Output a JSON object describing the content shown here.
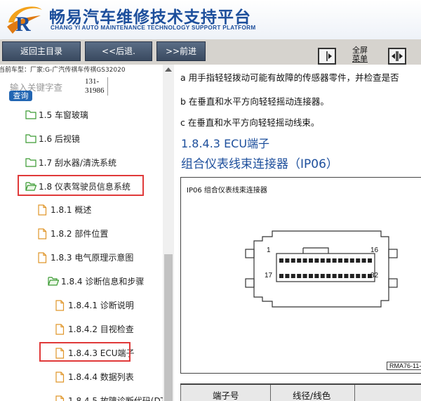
{
  "header": {
    "title_cn": "畅易汽车维修技术支持平台",
    "title_en": "CHANG YI AUTO MAINTENANCE TECHNOLOGY SUPPORT PLATFORM"
  },
  "toolbar": {
    "back_home": "返回主目录",
    "back": "<<后退.",
    "forward": ">>前进",
    "fullscreen_line1": "全屏",
    "fullscreen_line2": "菜单"
  },
  "left": {
    "vehicle": "当前车型：厂家:G-广汽传祺车传祺GS32020",
    "search_placeholder": "输入关键字查",
    "search_button": "查询",
    "code_line1": "131-",
    "code_line2": "31986"
  },
  "tree": [
    {
      "label": "1.5 车窗玻璃",
      "type": "folder"
    },
    {
      "label": "1.6 后视镜",
      "type": "folder"
    },
    {
      "label": "1.7 刮水器/清洗系统",
      "type": "folder"
    },
    {
      "label": "1.8 仪表驾驶员信息系统",
      "type": "folder-open"
    },
    {
      "label": "1.8.1 概述",
      "type": "doc"
    },
    {
      "label": "1.8.2 部件位置",
      "type": "doc"
    },
    {
      "label": "1.8.3 电气原理示意图",
      "type": "doc"
    },
    {
      "label": "1.8.4 诊断信息和步骤",
      "type": "folder-open"
    },
    {
      "label": "1.8.4.1 诊断说明",
      "type": "doc"
    },
    {
      "label": "1.8.4.2 目视检查",
      "type": "doc"
    },
    {
      "label": "1.8.4.3 ECU端子",
      "type": "doc"
    },
    {
      "label": "1.8.4.4 数据列表",
      "type": "doc"
    },
    {
      "label": "1.8.4.5 故障诊断代码(DT",
      "type": "doc"
    }
  ],
  "content": {
    "line_a": "a 用手指轻轻拨动可能有故障的传感器零件，并检查是否",
    "line_b": "b 在垂直和水平方向轻轻摇动连接器。",
    "line_c": "c 在垂直和水平方向轻轻摇动线束。",
    "heading": "1.8.4.3 ECU端子",
    "subheading": "组合仪表线束连接器（IP06）",
    "diagram_label": "IP06    组合仪表线束连接器",
    "pin_1": "1",
    "pin_16": "16",
    "pin_17": "17",
    "pin_32": "32",
    "diagram_code": "RMA76-11-",
    "col_terminal": "端子号",
    "col_wire": "线径/线色"
  },
  "colors": {
    "brand_blue": "#1d4f9c",
    "highlight_red": "#e03a3a",
    "toolbar_button": "#4a5b72"
  }
}
